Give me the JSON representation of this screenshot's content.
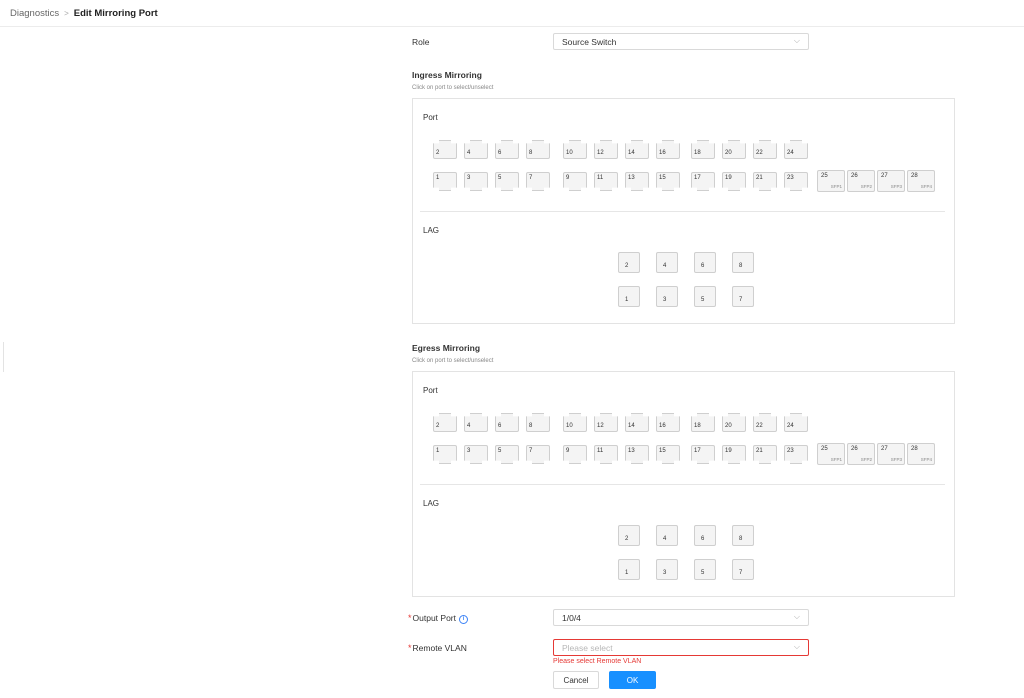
{
  "breadcrumb": {
    "parent": "Diagnostics",
    "separator": ">",
    "current": "Edit Mirroring Port"
  },
  "role": {
    "label": "Role",
    "value": "Source Switch"
  },
  "ingress": {
    "title": "Ingress Mirroring",
    "hint": "Click on port to select/unselect",
    "port_label": "Port",
    "lag_label": "LAG"
  },
  "egress": {
    "title": "Egress Mirroring",
    "hint": "Click on port to select/unselect",
    "port_label": "Port",
    "lag_label": "LAG"
  },
  "ports": {
    "top_row": [
      "2",
      "4",
      "6",
      "8",
      "10",
      "12",
      "14",
      "16",
      "18",
      "20",
      "22",
      "24"
    ],
    "bottom_row": [
      "1",
      "3",
      "5",
      "7",
      "9",
      "11",
      "13",
      "15",
      "17",
      "19",
      "21",
      "23"
    ],
    "sfp": [
      {
        "num": "25",
        "sub": "SFP1"
      },
      {
        "num": "26",
        "sub": "SFP2"
      },
      {
        "num": "27",
        "sub": "SFP3"
      },
      {
        "num": "28",
        "sub": "SFP4"
      }
    ]
  },
  "lags": {
    "top_row": [
      "2",
      "4",
      "6",
      "8"
    ],
    "bottom_row": [
      "1",
      "3",
      "5",
      "7"
    ]
  },
  "output_port": {
    "required_mark": "*",
    "label": "Output Port",
    "value": "1/0/4"
  },
  "remote_vlan": {
    "required_mark": "*",
    "label": "Remote VLAN",
    "placeholder": "Please select",
    "error": "Please select Remote VLAN"
  },
  "buttons": {
    "cancel": "Cancel",
    "ok": "OK"
  },
  "icons": {
    "chevron": "chevron-down-icon",
    "info": "info-icon"
  },
  "colors": {
    "primary": "#1890ff",
    "error": "#e53935"
  }
}
